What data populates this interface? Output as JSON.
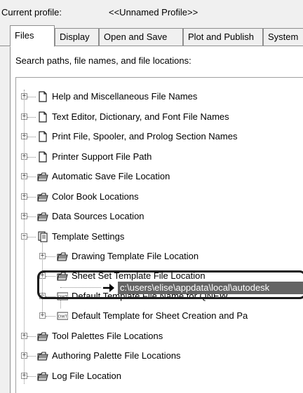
{
  "header": {
    "current_profile_label": "Current profile:",
    "profile_name": "<<Unnamed Profile>>"
  },
  "tabs": [
    {
      "label": "Files",
      "active": true
    },
    {
      "label": "Display"
    },
    {
      "label": "Open and Save"
    },
    {
      "label": "Plot and Publish"
    },
    {
      "label": "System"
    }
  ],
  "files_panel": {
    "caption": "Search paths, file names, and file locations:",
    "items": [
      {
        "label": "Help and Miscellaneous File Names",
        "icon": "document-icon"
      },
      {
        "label": "Text Editor, Dictionary, and Font File Names",
        "icon": "document-icon"
      },
      {
        "label": "Print File, Spooler, and Prolog Section Names",
        "icon": "document-icon"
      },
      {
        "label": "Printer Support File Path",
        "icon": "document-icon"
      },
      {
        "label": "Automatic Save File Location",
        "icon": "folder-stack-icon"
      },
      {
        "label": "Color Book Locations",
        "icon": "folder-stack-icon"
      },
      {
        "label": "Data Sources Location",
        "icon": "folder-stack-icon"
      },
      {
        "label": "Template Settings",
        "icon": "template-settings-icon"
      },
      {
        "label": "Drawing Template File Location",
        "icon": "folder-stack-icon"
      },
      {
        "label": "Sheet Set Template File Location",
        "icon": "folder-stack-icon"
      },
      {
        "label": "Default Template File Name for QNEW",
        "icon": "dwt-file-icon"
      },
      {
        "label": "c:\\users\\elise\\appdata\\local\\autodesk",
        "icon": "arrow-icon"
      },
      {
        "label": "Default Template for Sheet Creation and Pa",
        "icon": "dwt-file-icon"
      },
      {
        "label": "Tool Palettes File Locations",
        "icon": "folder-stack-icon"
      },
      {
        "label": "Authoring Palette File Locations",
        "icon": "folder-stack-icon"
      },
      {
        "label": "Log File Location",
        "icon": "folder-stack-icon"
      }
    ],
    "expander_plus": "+",
    "expander_minus": "−",
    "dwt_text": "DWT"
  },
  "colors": {
    "selection": "#646464",
    "highlight_frame": "#1a1a1a",
    "background": "#f0f0f0"
  }
}
